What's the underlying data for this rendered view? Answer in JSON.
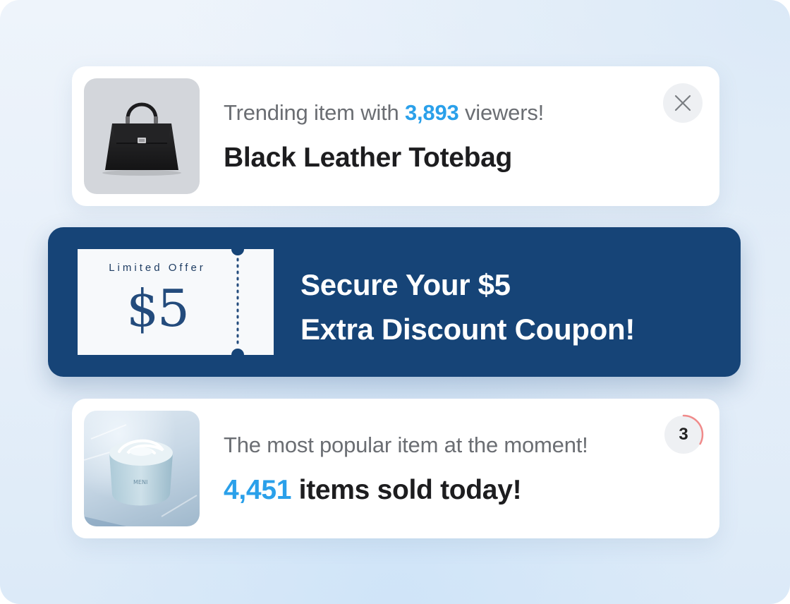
{
  "trending_card": {
    "product_image_alt": "Black leather tote bag",
    "prefix": "Trending item with",
    "viewer_count": "3,893",
    "suffix": "viewers!",
    "product_name": "Black Leather Totebag",
    "close_icon": "close-icon"
  },
  "coupon_banner": {
    "coupon_label": "Limited Offer",
    "coupon_amount": "$5",
    "title_line1": "Secure Your $5",
    "title_line2": "Extra Discount Coupon!"
  },
  "popular_card": {
    "product_image_alt": "Moisturizer cream jar",
    "tagline": "The most popular item at the moment!",
    "sold_count": "4,451",
    "sold_suffix": "items sold today!",
    "countdown_value": "3",
    "countdown_progress": 0.33
  },
  "colors": {
    "accent": "#2aa0ea",
    "banner": "#164477",
    "countdown_ring": "#f08a8a"
  }
}
